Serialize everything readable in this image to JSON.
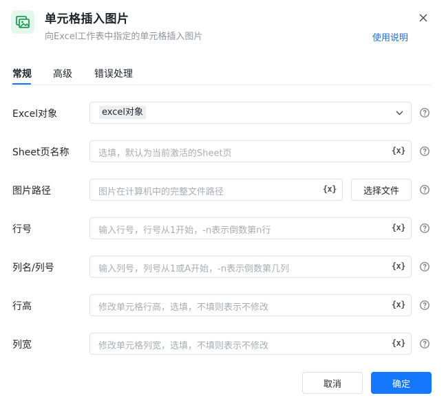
{
  "header": {
    "title": "单元格插入图片",
    "subtitle": "向Excel工作表中指定的单元格插入图片",
    "help_link": "使用说明",
    "icon": "image-icon",
    "close_icon": "close-icon"
  },
  "tabs": [
    {
      "label": "常规",
      "active": true
    },
    {
      "label": "高级",
      "active": false
    },
    {
      "label": "错误处理",
      "active": false
    }
  ],
  "form": {
    "excel_object": {
      "label": "Excel对象",
      "value": "excel对象"
    },
    "sheet_name": {
      "label": "Sheet页名称",
      "placeholder": "选填，默认为当前激活的Sheet页"
    },
    "image_path": {
      "label": "图片路径",
      "placeholder": "图片在计算机中的完整文件路径",
      "button": "选择文件"
    },
    "row": {
      "label": "行号",
      "placeholder": "输入行号，行号从1开始，-n表示倒数第n行"
    },
    "column": {
      "label": "列名/列号",
      "placeholder": "输入列号，列号从1或A开始，-n表示倒数第几列"
    },
    "row_height": {
      "label": "行高",
      "placeholder": "修改单元格行高，选填，不填则表示不修改"
    },
    "col_width": {
      "label": "列宽",
      "placeholder": "修改单元格列宽，选填，不填则表示不修改"
    },
    "variable_icon_text": "{x}"
  },
  "footer": {
    "cancel": "取消",
    "ok": "确定"
  },
  "colors": {
    "accent": "#1677ff",
    "link": "#1f6dd6",
    "icon_green": "#1a9a55",
    "icon_bg": "#e5f6ec"
  }
}
